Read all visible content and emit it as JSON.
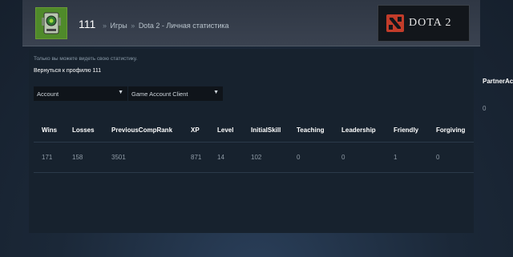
{
  "header": {
    "title": "111",
    "breadcrumbs": [
      "Игры",
      "Dota 2 - Личная статистика"
    ],
    "breadcrumb_separator": "»",
    "logo_text": "DOTA 2"
  },
  "page": {
    "notice": "Только вы можете видеть свою статистику.",
    "back_link": "Вернуться к профилю 111"
  },
  "filters": [
    {
      "value": "Account",
      "options_visible": false
    },
    {
      "value": "Game Account Client",
      "options_visible": false
    }
  ],
  "table": {
    "columns": [
      "Wins",
      "Losses",
      "PreviousCompRank",
      "XP",
      "Level",
      "InitialSkill",
      "Teaching",
      "Leadership",
      "Friendly",
      "Forgiving",
      "PartnerAc"
    ],
    "rows": [
      [
        "171",
        "158",
        "3501",
        "871",
        "14",
        "102",
        "0",
        "0",
        "1",
        "0",
        "0"
      ]
    ]
  },
  "colors": {
    "background": "#1b2838",
    "header": "#2f3744",
    "panel": "#17222e",
    "dota_red": "#c23c2a",
    "avatar_green": "#4a7a26"
  },
  "icons": [
    "avatar-robot-icon",
    "dota-logo-icon",
    "chevron-down-icon"
  ]
}
